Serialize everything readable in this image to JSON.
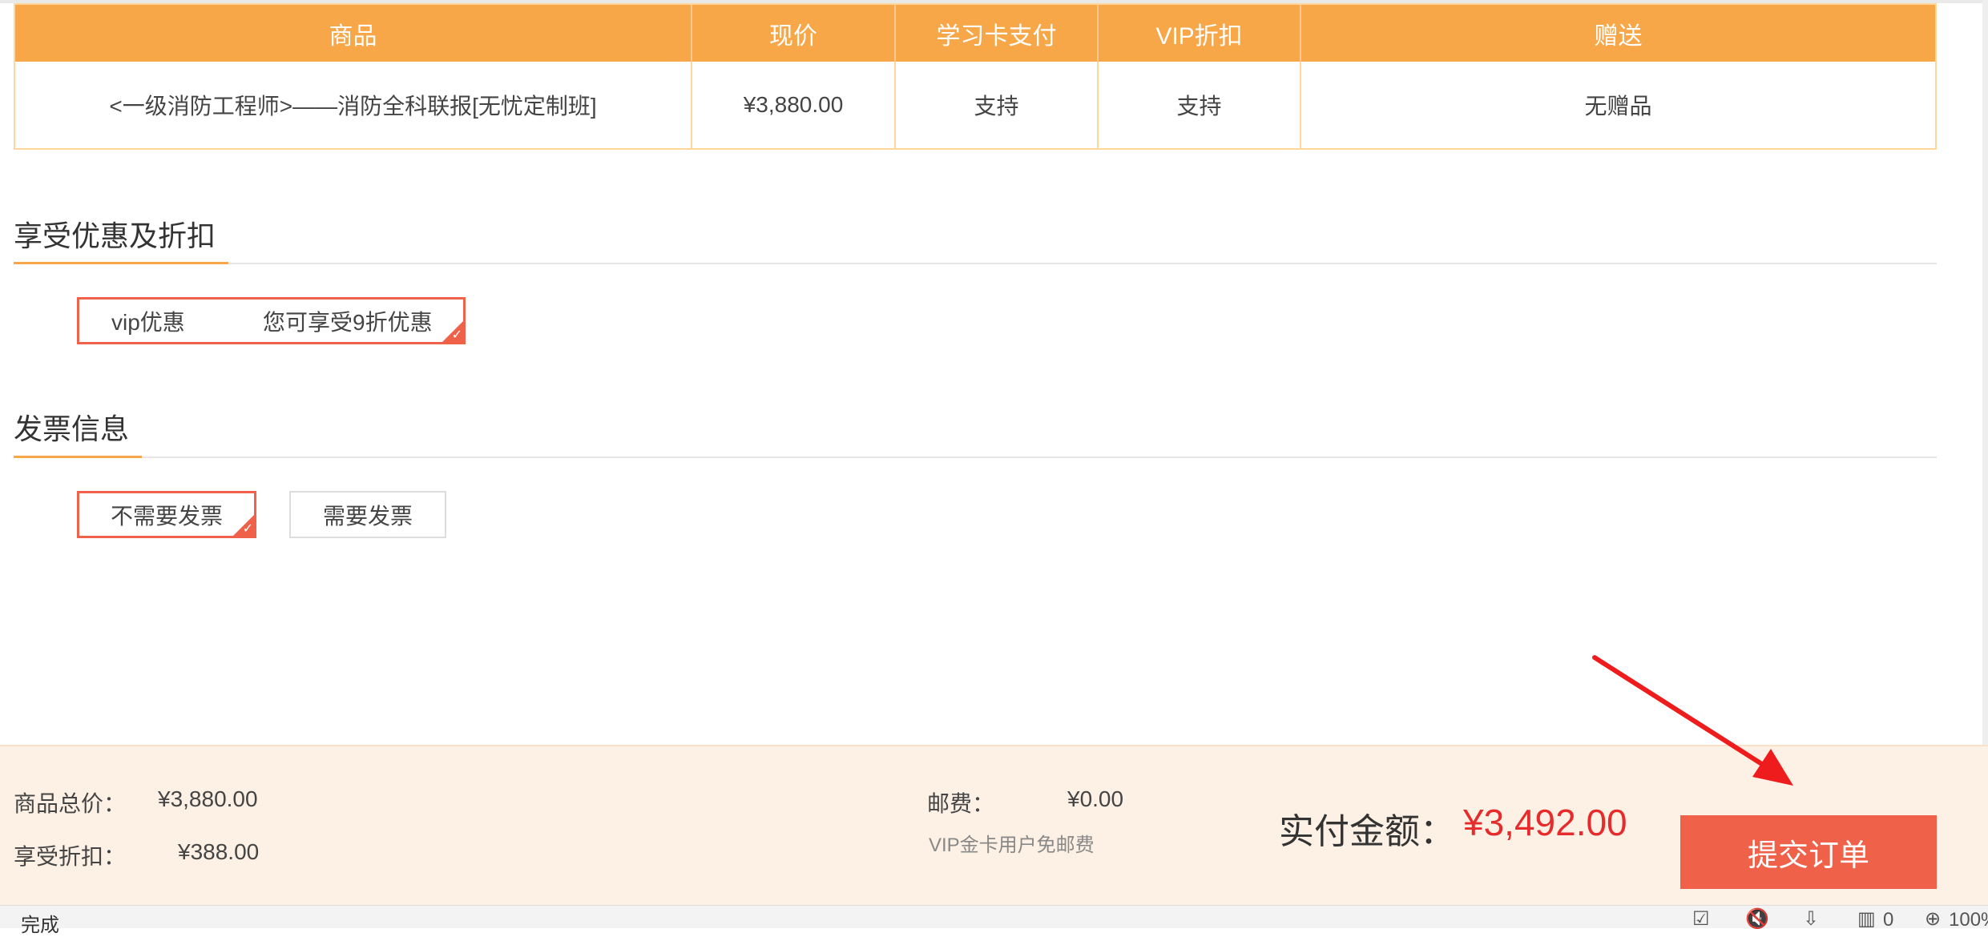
{
  "table": {
    "headers": [
      "商品",
      "现价",
      "学习卡支付",
      "VIP折扣",
      "赠送"
    ],
    "row": [
      "<一级消防工程师>——消防全科联报[无忧定制班]",
      "¥3,880.00",
      "支持",
      "支持",
      "无赠品"
    ]
  },
  "discount_section": {
    "title": "享受优惠及折扣",
    "option": {
      "name": "vip优惠",
      "desc": "您可享受9折优惠",
      "selected": true
    }
  },
  "invoice_section": {
    "title": "发票信息",
    "options": [
      {
        "label": "不需要发票",
        "selected": true
      },
      {
        "label": "需要发票",
        "selected": false
      }
    ]
  },
  "summary": {
    "total_label": "商品总价：",
    "total_value": "¥3,880.00",
    "discount_label": "享受折扣：",
    "discount_value": "¥388.00",
    "shipping_label": "邮费：",
    "shipping_value": "¥0.00",
    "shipping_note": "VIP金卡用户免邮费",
    "pay_label": "实付金额：",
    "pay_value": "¥3,492.00",
    "submit_label": "提交订单"
  },
  "statusbar": {
    "status": "完成",
    "count": "0",
    "zoom": "100%"
  },
  "colors": {
    "header_orange": "#f8a748",
    "accent_red": "#f0614a",
    "price_red": "#e52b2b",
    "summary_bg": "#fdf0e4"
  }
}
